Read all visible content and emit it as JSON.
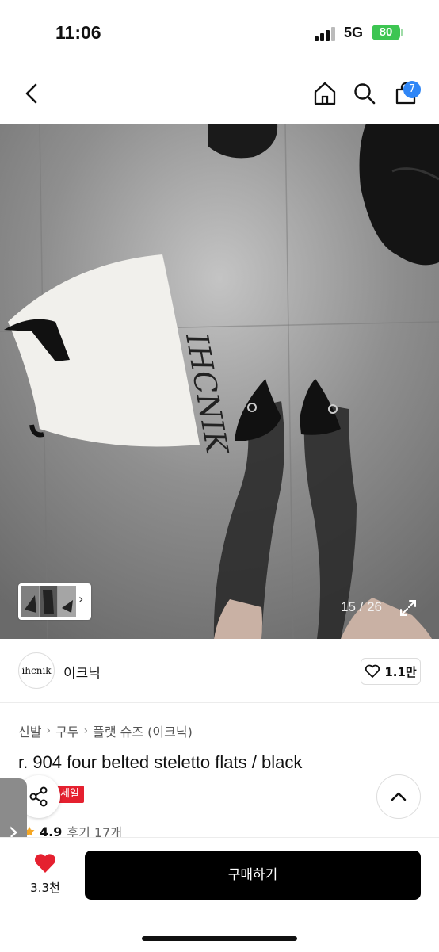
{
  "status_bar": {
    "time": "11:06",
    "network": "5G",
    "battery": "80"
  },
  "nav": {
    "cart_count": "7"
  },
  "gallery": {
    "counter": "15 / 26"
  },
  "shop": {
    "logo_text": "ihcnik",
    "name": "이크닉",
    "likes": "1.1만"
  },
  "breadcrumb": {
    "items": [
      "신발",
      "구두",
      "플랫 슈즈 (이크닉)"
    ]
  },
  "product": {
    "title": "r. 904 four belted steletto flats / black",
    "badge": "세일",
    "rating": "4.9",
    "reviews": "후기 17개"
  },
  "bottom_bar": {
    "wish_count": "3.3천",
    "buy_label": "구매하기"
  },
  "colors": {
    "accent_red": "#e5202f",
    "badge_blue": "#2f86f6",
    "battery_green": "#3dc552"
  }
}
